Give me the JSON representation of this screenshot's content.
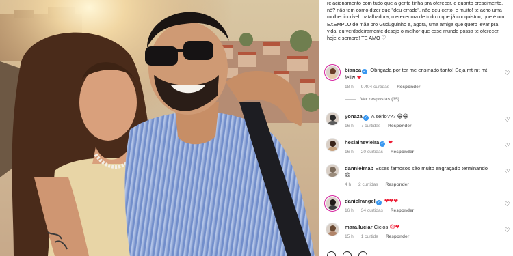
{
  "post": {
    "caption": "relacionamento com tudo que a gente tinha pra oferecer. e quanto crescimento, né? não tem como dizer que \"deu errado\". não deu certo, e muito! te acho uma mulher incrível, batalhadora, merecedora de tudo o que já conquistou, que é um EXEMPLO de mãe pro Guduguinho e, agora, uma amiga que quero levar pra vida. eu verdadeiramente desejo o melhor que esse mundo possa te oferecer. hoje e sempre! TE AMO ♡"
  },
  "comments": [
    {
      "user": "bianca",
      "verified": true,
      "text": "Obrigada por ter me ensinado tanto! Seja mt mt mt feliz!",
      "emoji": "❤",
      "time": "18 h",
      "likes": "9.404 curtidas",
      "reply_label": "Responder",
      "view_replies": "Ver respostas (35)"
    },
    {
      "user": "yonaza",
      "verified": true,
      "text": "A sério???",
      "emoji": "😁😁",
      "time": "16 h",
      "likes": "7 curtidas",
      "reply_label": "Responder"
    },
    {
      "user": "heslainevieira",
      "verified": true,
      "text": "",
      "emoji": "❤",
      "time": "16 h",
      "likes": "20 curtidas",
      "reply_label": "Responder"
    },
    {
      "user": "danniełmab",
      "verified": false,
      "text": "Esses famosos são muito engraçado terminando",
      "emoji": "😄",
      "time": "4 h",
      "likes": "2 curtidas",
      "reply_label": "Responder"
    },
    {
      "user": "danielrangel",
      "verified": true,
      "text": "",
      "emoji": "❤❤❤",
      "time": "16 h",
      "likes": "34 curtidas",
      "reply_label": "Responder"
    },
    {
      "user": "mara.luciar",
      "verified": false,
      "text": "Ciclos",
      "emoji": "😊❤",
      "time": "15 h",
      "likes": "1 curtida",
      "reply_label": "Responder"
    }
  ],
  "icons": {
    "like": "heart-outline-icon",
    "verified": "verified-badge-icon"
  },
  "colors": {
    "verified": "#3897f0",
    "heart_red": "#ed1b33",
    "meta_grey": "#8e8e8e"
  }
}
